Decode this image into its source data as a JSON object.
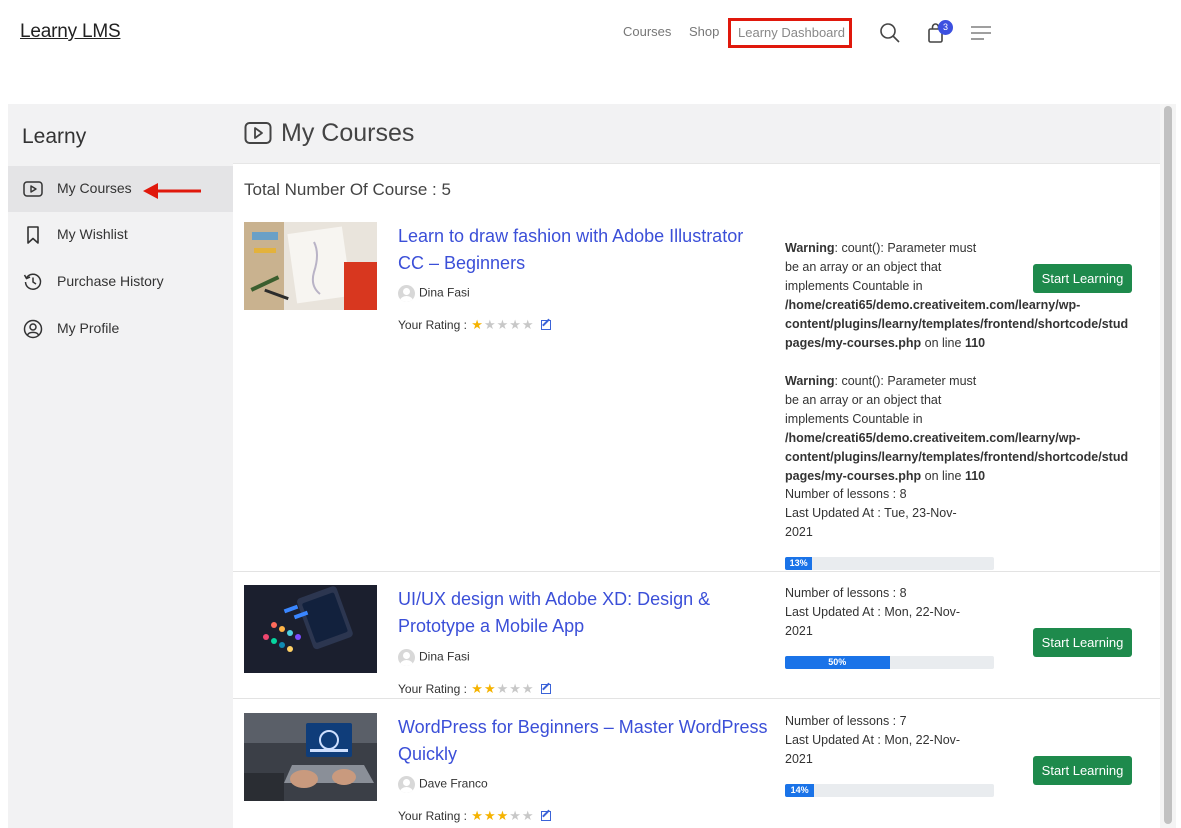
{
  "header": {
    "logo": "Learny LMS",
    "nav": {
      "courses": "Courses",
      "shop": "Shop",
      "dashboard": "Learny Dashboard"
    },
    "cart_count": "3"
  },
  "sidebar": {
    "title": "Learny",
    "items": [
      {
        "label": "My Courses",
        "icon": "play-circle-icon",
        "active": true
      },
      {
        "label": "My Wishlist",
        "icon": "bookmark-icon"
      },
      {
        "label": "Purchase History",
        "icon": "history-icon"
      },
      {
        "label": "My Profile",
        "icon": "user-circle-icon"
      }
    ]
  },
  "main": {
    "title": "My Courses",
    "total": "Total Number Of Course : 5",
    "rating_label": "Your Rating :",
    "button_label": "Start Learning",
    "warning": {
      "label": "Warning",
      "line1": ": count(): Parameter must",
      "line2": "be an array or an object that",
      "line3": "implements Countable in",
      "path1": "/home/creati65/demo.creativeitem.com/learny/wp-",
      "path2": "content/plugins/learny/templates/frontend/shortcode/stud",
      "path3": "pages/my-courses.php",
      "online": " on line ",
      "lineno": "110"
    },
    "courses": [
      {
        "title": "Learn to draw fashion with Adobe Illustrator CC – Beginners",
        "author": "Dina Fasi",
        "rating": 1,
        "lessons": "Number of lessons : 8",
        "updated1": "Last Updated At : Tue, 23-Nov-",
        "updated2": "2021",
        "progress": 13,
        "progress_label": "13%"
      },
      {
        "title": "UI/UX design with Adobe XD: Design & Prototype a Mobile App",
        "author": "Dina Fasi",
        "rating": 2,
        "lessons": "Number of lessons : 8",
        "updated1": "Last Updated At : Mon, 22-Nov-",
        "updated2": "2021",
        "progress": 50,
        "progress_label": "50%"
      },
      {
        "title": "WordPress for Beginners – Master WordPress Quickly",
        "author": "Dave Franco",
        "rating": 3,
        "lessons": "Number of lessons : 7",
        "updated1": "Last Updated At : Mon, 22-Nov-",
        "updated2": "2021",
        "progress": 14,
        "progress_label": "14%"
      }
    ]
  },
  "colors": {
    "link": "#3b4fd8",
    "button": "#1e8a4c",
    "progress": "#1a73e8",
    "highlight": "#e0180c",
    "star": "#f5b301"
  }
}
